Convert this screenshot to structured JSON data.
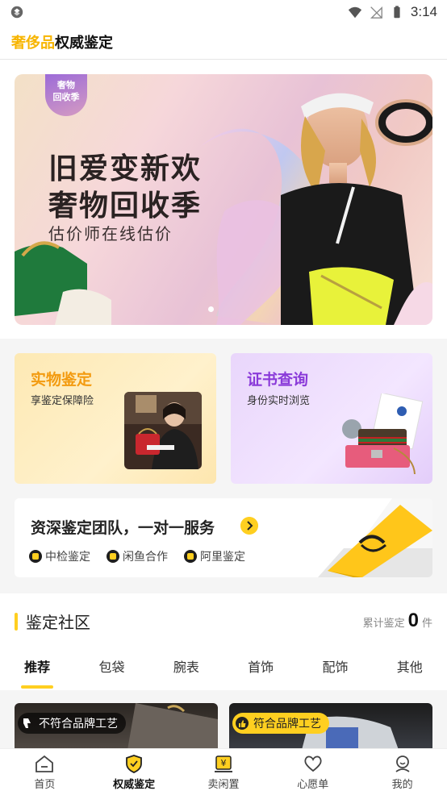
{
  "status_bar": {
    "time": "3:14"
  },
  "header": {
    "brand_accent": "奢侈品",
    "brand_rest": "权威鉴定",
    "accent_color": "#f7b500"
  },
  "banner": {
    "badge_line1": "奢物",
    "badge_line2": "回收季",
    "title_line1": "旧爱变新欢",
    "title_line2": "奢物回收季",
    "subtitle": "估价师在线估价"
  },
  "services": {
    "physical": {
      "title": "实物鉴定",
      "subtitle": "享鉴定保障险"
    },
    "certificate": {
      "title": "证书查询",
      "subtitle": "身份实时浏览"
    }
  },
  "team": {
    "title": "资深鉴定团队，一对一服务",
    "tags": [
      "中检鉴定",
      "闲鱼合作",
      "阿里鉴定"
    ]
  },
  "community": {
    "title": "鉴定社区",
    "count_prefix": "累计鉴定",
    "count": "0",
    "count_suffix": "件",
    "tabs": [
      "推荐",
      "包袋",
      "腕表",
      "首饰",
      "配饰",
      "其他"
    ],
    "active_tab": "推荐",
    "feed": [
      {
        "verdict": "不符合品牌工艺"
      },
      {
        "verdict": "符合品牌工艺"
      }
    ]
  },
  "bottom_nav": {
    "items": [
      "首页",
      "权威鉴定",
      "卖闲置",
      "心愿单",
      "我的"
    ],
    "active": "权威鉴定"
  }
}
